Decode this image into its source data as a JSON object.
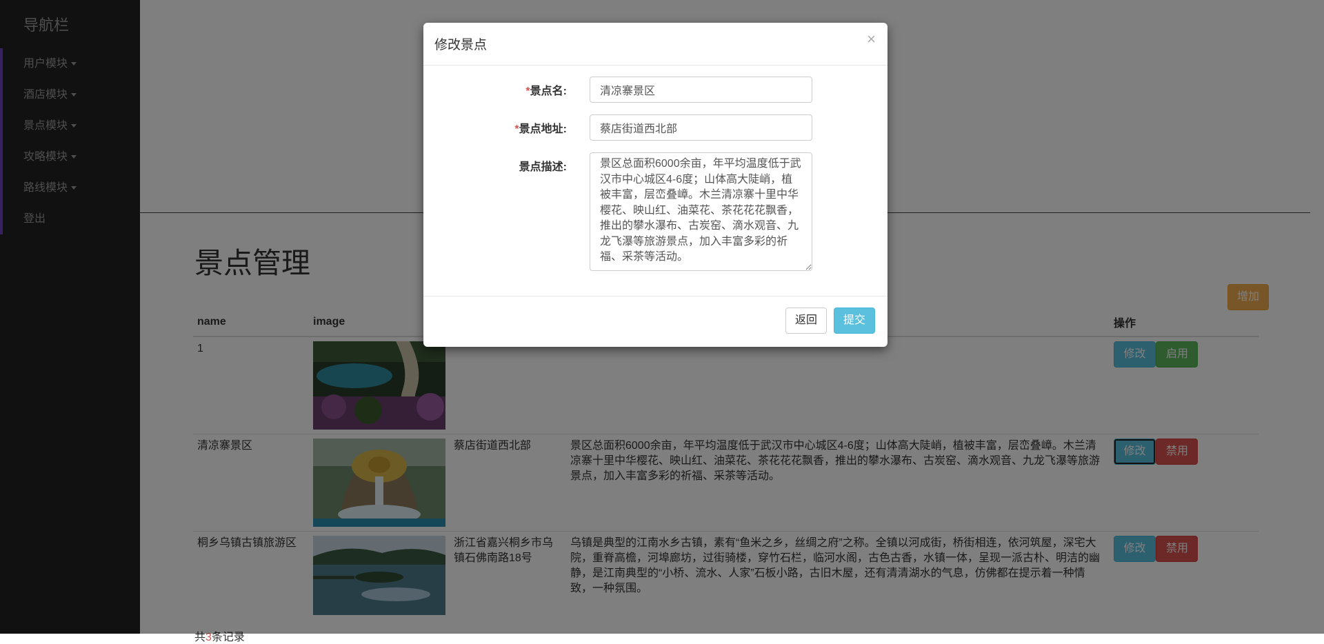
{
  "sidebar": {
    "brand": "导航栏",
    "items": [
      {
        "label": "用户模块",
        "dropdown": true
      },
      {
        "label": "酒店模块",
        "dropdown": true
      },
      {
        "label": "景点模块",
        "dropdown": true
      },
      {
        "label": "攻略模块",
        "dropdown": true
      },
      {
        "label": "路线模块",
        "dropdown": true
      },
      {
        "label": "登出",
        "dropdown": false
      }
    ]
  },
  "page": {
    "title": "景点管理",
    "add_label": "增加",
    "footer_prefix": "共",
    "footer_count": "3",
    "footer_suffix": "条记录"
  },
  "table": {
    "headers": {
      "name": "name",
      "image": "image",
      "address": "",
      "desc": "",
      "ops": "操作"
    },
    "rows": [
      {
        "name": "1",
        "image": "lake-and-road-photo",
        "address": "",
        "desc": "",
        "edit_label": "修改",
        "toggle_label": "启用",
        "toggle_type": "success"
      },
      {
        "name": "清凉寨景区",
        "image": "dragon-waterfall-photo",
        "address": "蔡店街道西北部",
        "desc": "景区总面积6000余亩，年平均温度低于武汉市中心城区4-6度；山体高大陡峭，植被丰富，层峦叠嶂。木兰清凉寨十里中华樱花、映山红、油菜花、茶花花花飘香，推出的攀水瀑布、古炭窑、滴水观音、九龙飞瀑等旅游景点，加入丰富多彩的祈福、采茶等活动。",
        "edit_label": "修改",
        "toggle_label": "禁用",
        "toggle_type": "danger"
      },
      {
        "name": "桐乡乌镇古镇旅游区",
        "image": "water-town-photo",
        "address": "浙江省嘉兴桐乡市乌镇石佛南路18号",
        "desc": "乌镇是典型的江南水乡古镇，素有“鱼米之乡，丝绸之府”之称。全镇以河成街，桥街相连，依河筑屋，深宅大院，重脊高檐，河埠廊坊，过街骑楼，穿竹石栏，临河水阁，古色古香，水镇一体，呈现一派古朴、明洁的幽静，是江南典型的“小桥、流水、人家”石板小路，古旧木屋，还有清清湖水的气息，仿佛都在提示着一种情致，一种氛围。",
        "edit_label": "修改",
        "toggle_label": "禁用",
        "toggle_type": "danger"
      }
    ]
  },
  "modal": {
    "title": "修改景点",
    "close_glyph": "×",
    "required_mark": "*",
    "fields": {
      "name_label": "景点名:",
      "name_value": "清凉寨景区",
      "address_label": "景点地址:",
      "address_value": "蔡店街道西北部",
      "desc_label": "景点描述:",
      "desc_value": "景区总面积6000余亩，年平均温度低于武汉市中心城区4-6度；山体高大陡峭，植被丰富，层峦叠嶂。木兰清凉寨十里中华樱花、映山红、油菜花、茶花花花飘香，推出的攀水瀑布、古炭窑、滴水观音、九龙飞瀑等旅游景点，加入丰富多彩的祈福、采茶等活动。"
    },
    "back_label": "返回",
    "submit_label": "提交"
  },
  "colors": {
    "sidebar_bg": "#222222",
    "accent": "#6f42c1",
    "info": "#5bc0de",
    "success": "#5cb85c",
    "danger": "#d9534f",
    "warning": "#f0ad4e"
  }
}
